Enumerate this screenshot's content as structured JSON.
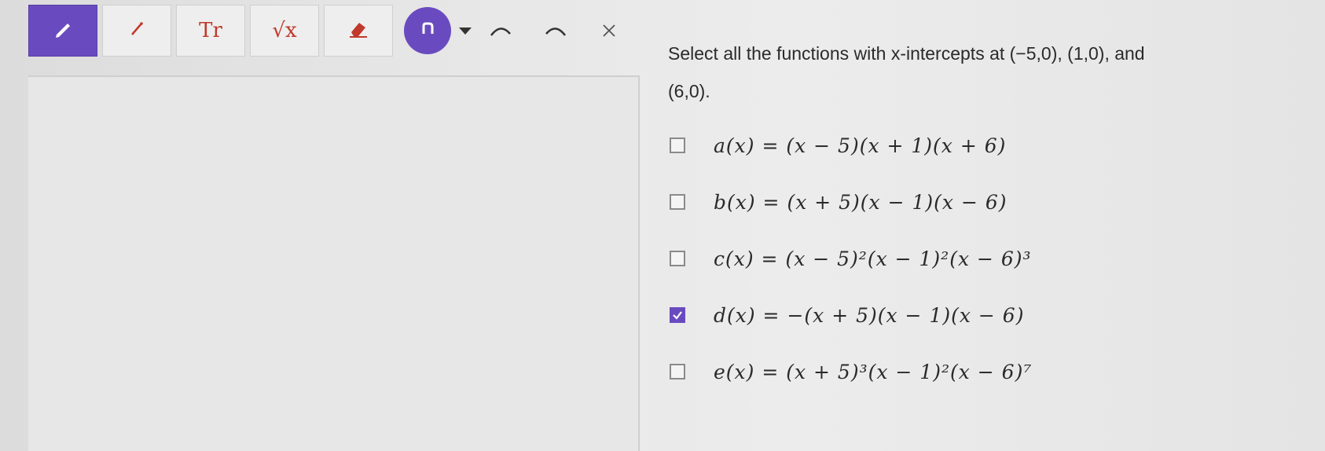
{
  "toolbar": {
    "tools": [
      {
        "name": "pencil-tool",
        "icon": "pencil-icon",
        "active": true,
        "glyph": ""
      },
      {
        "name": "line-tool",
        "icon": "pen-icon",
        "active": false,
        "glyph": "⁄"
      },
      {
        "name": "text-tool",
        "icon": "text-icon",
        "active": false,
        "glyph": "Tr"
      },
      {
        "name": "math-tool",
        "icon": "square-root-icon",
        "active": false,
        "glyph": "√x"
      },
      {
        "name": "eraser-tool",
        "icon": "eraser-icon",
        "active": false,
        "glyph": ""
      }
    ],
    "undo_icon": "undo-icon",
    "accent": "#6a4bbf"
  },
  "question": {
    "text_line1": "Select all the functions with x-intercepts at (−5,0), (1,0), and",
    "text_line2": "(6,0)."
  },
  "options": [
    {
      "label": "a(x) = (x − 5)(x + 1)(x + 6)",
      "checked": false
    },
    {
      "label": "b(x) = (x + 5)(x − 1)(x − 6)",
      "checked": false
    },
    {
      "label": "c(x) = (x − 5)²(x − 1)²(x − 6)³",
      "checked": false
    },
    {
      "label": "d(x) = −(x + 5)(x − 1)(x − 6)",
      "checked": true
    },
    {
      "label": "e(x) = (x + 5)³(x − 1)²(x − 6)⁷",
      "checked": false
    }
  ]
}
